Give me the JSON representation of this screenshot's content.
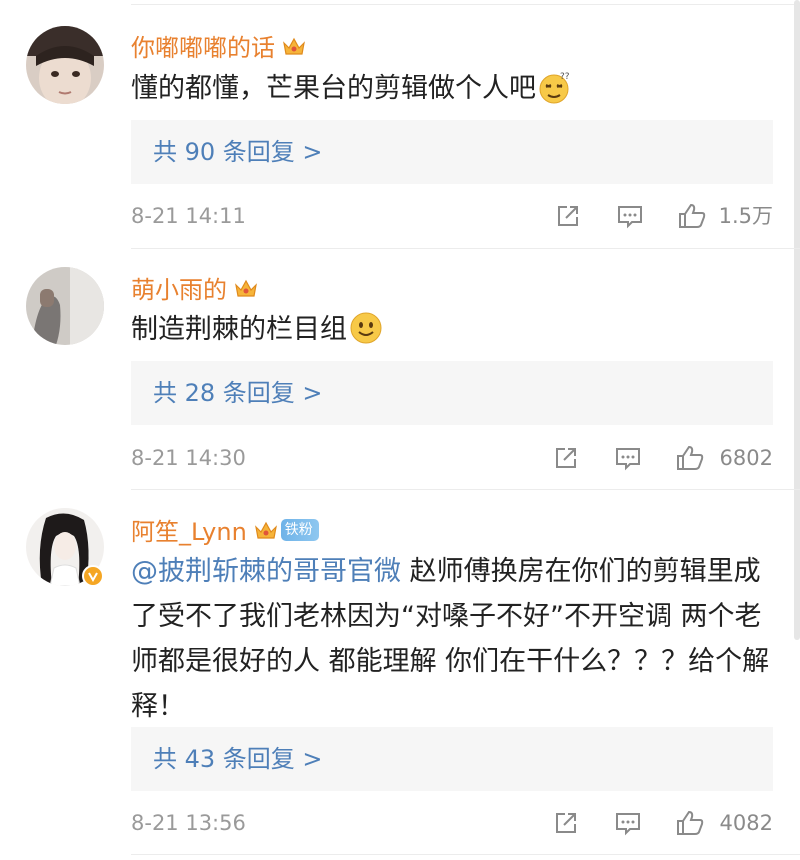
{
  "comments": [
    {
      "username": "你嘟嘟嘟的话",
      "text": "懂的都懂，芒果台的剪辑做个人吧",
      "emoji_icon": "dizzy-face-emoji",
      "reply_count_label": "共 90 条回复 >",
      "time": "8-21 14:11",
      "likes": "1.5万"
    },
    {
      "username": "萌小雨的",
      "text": "制造荆棘的栏目组",
      "emoji_icon": "smile-emoji",
      "reply_count_label": "共 28 条回复 >",
      "time": "8-21 14:30",
      "likes": "6802"
    },
    {
      "username": "阿笙_Lynn",
      "fan_badge": "铁粉",
      "mention": "@披荆斩棘的哥哥官微",
      "text": " 赵师傅换房在你们的剪辑里成了受不了我们老林因为“对嗓子不好”不开空调 两个老师都是很好的人 都能理解 你们在干什么？？？给个解释！",
      "reply_count_label": "共 43 条回复 >",
      "time": "8-21 13:56",
      "likes": "4082"
    }
  ],
  "colors": {
    "username": "#e8812f",
    "link": "#4e7fb8",
    "meta": "#9a9a9a",
    "reply_bg": "#f6f6f6"
  }
}
